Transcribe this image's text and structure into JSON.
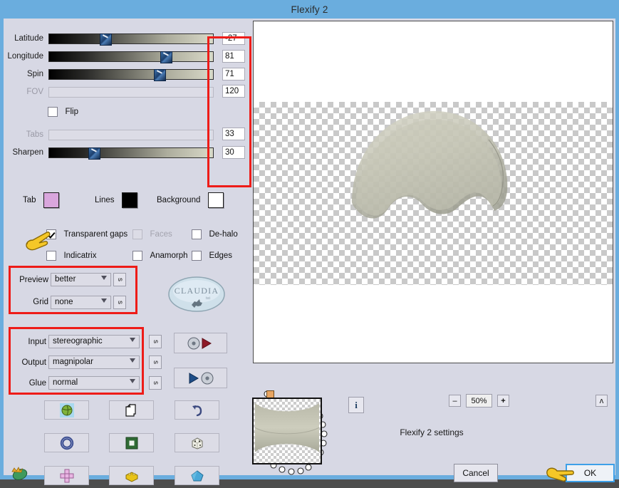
{
  "window": {
    "title": "Flexify 2"
  },
  "sliders": [
    {
      "label": "Latitude",
      "value": "-27",
      "pos": 31,
      "enabled": true
    },
    {
      "label": "Longitude",
      "value": "81",
      "pos": 68,
      "enabled": true
    },
    {
      "label": "Spin",
      "value": "71",
      "pos": 64,
      "enabled": true
    },
    {
      "label": "FOV",
      "value": "120",
      "pos": 0,
      "enabled": false
    },
    {
      "label": "Tabs",
      "value": "33",
      "pos": 0,
      "enabled": false
    },
    {
      "label": "Sharpen",
      "value": "30",
      "pos": 24,
      "enabled": true
    }
  ],
  "flip": {
    "label": "Flip",
    "checked": false
  },
  "swatches": [
    {
      "label": "Tab",
      "color": "#d9a6dd"
    },
    {
      "label": "Lines",
      "color": "#000000"
    },
    {
      "label": "Background",
      "color": "#ffffff"
    }
  ],
  "checkboxes": [
    {
      "label": "Transparent gaps",
      "checked": true,
      "enabled": true
    },
    {
      "label": "Faces",
      "checked": false,
      "enabled": false
    },
    {
      "label": "De-halo",
      "checked": false,
      "enabled": true
    },
    {
      "label": "Indicatrix",
      "checked": false,
      "enabled": true
    },
    {
      "label": "Anamorph",
      "checked": false,
      "enabled": true
    },
    {
      "label": "Edges",
      "checked": false,
      "enabled": true
    }
  ],
  "preview_group": {
    "preview": {
      "label": "Preview",
      "value": "better",
      "side_button": "s"
    },
    "grid": {
      "label": "Grid",
      "value": "none",
      "side_button": "s"
    }
  },
  "projection_group": {
    "input": {
      "label": "Input",
      "value": "stereographic",
      "side_button": "s"
    },
    "output": {
      "label": "Output",
      "value": "magnipolar",
      "side_button": "s"
    },
    "glue": {
      "label": "Glue",
      "value": "normal",
      "side_button": "s"
    }
  },
  "tool_buttons": [
    {
      "name": "load-image-button",
      "icon": "globe-thumbnail-icon"
    },
    {
      "name": "copy-page-button",
      "icon": "pages-icon"
    },
    {
      "name": "undo-button",
      "icon": "undo-arrow-icon"
    },
    {
      "name": "torus-button",
      "icon": "blue-torus-icon"
    },
    {
      "name": "frame-button",
      "icon": "green-square-frame-icon"
    },
    {
      "name": "random-button",
      "icon": "dice-icon"
    },
    {
      "name": "cross-net-button",
      "icon": "pink-cross-net-icon"
    },
    {
      "name": "brick-button",
      "icon": "yellow-brick-icon"
    },
    {
      "name": "polyhedron-button",
      "icon": "blue-gem-icon"
    }
  ],
  "io_buttons": [
    {
      "name": "import-settings-button",
      "icon": "disc-play-red-icon"
    },
    {
      "name": "export-settings-button",
      "icon": "play-blue-disc-icon"
    }
  ],
  "watermark": {
    "text": "CLAUDIA",
    "sub": "tut"
  },
  "zoom": {
    "minus": "–",
    "value": "50%",
    "plus": "+"
  },
  "info_button": {
    "label": "i"
  },
  "collapse_button": {
    "label": "ʌ"
  },
  "status": {
    "text": "Flexify 2 settings"
  },
  "dialog_buttons": {
    "cancel": "Cancel",
    "ok": "OK"
  },
  "annotations": {
    "values_box": "red-highlight-values",
    "preview-grid-box": "red-highlight-preview-grid",
    "projection-box": "red-highlight-projection"
  },
  "colors": {
    "titlebar": "#6aadde",
    "panel": "#d7d8e4",
    "annotation_red": "#ee1c18",
    "accent_blue": "#3da0e8"
  }
}
